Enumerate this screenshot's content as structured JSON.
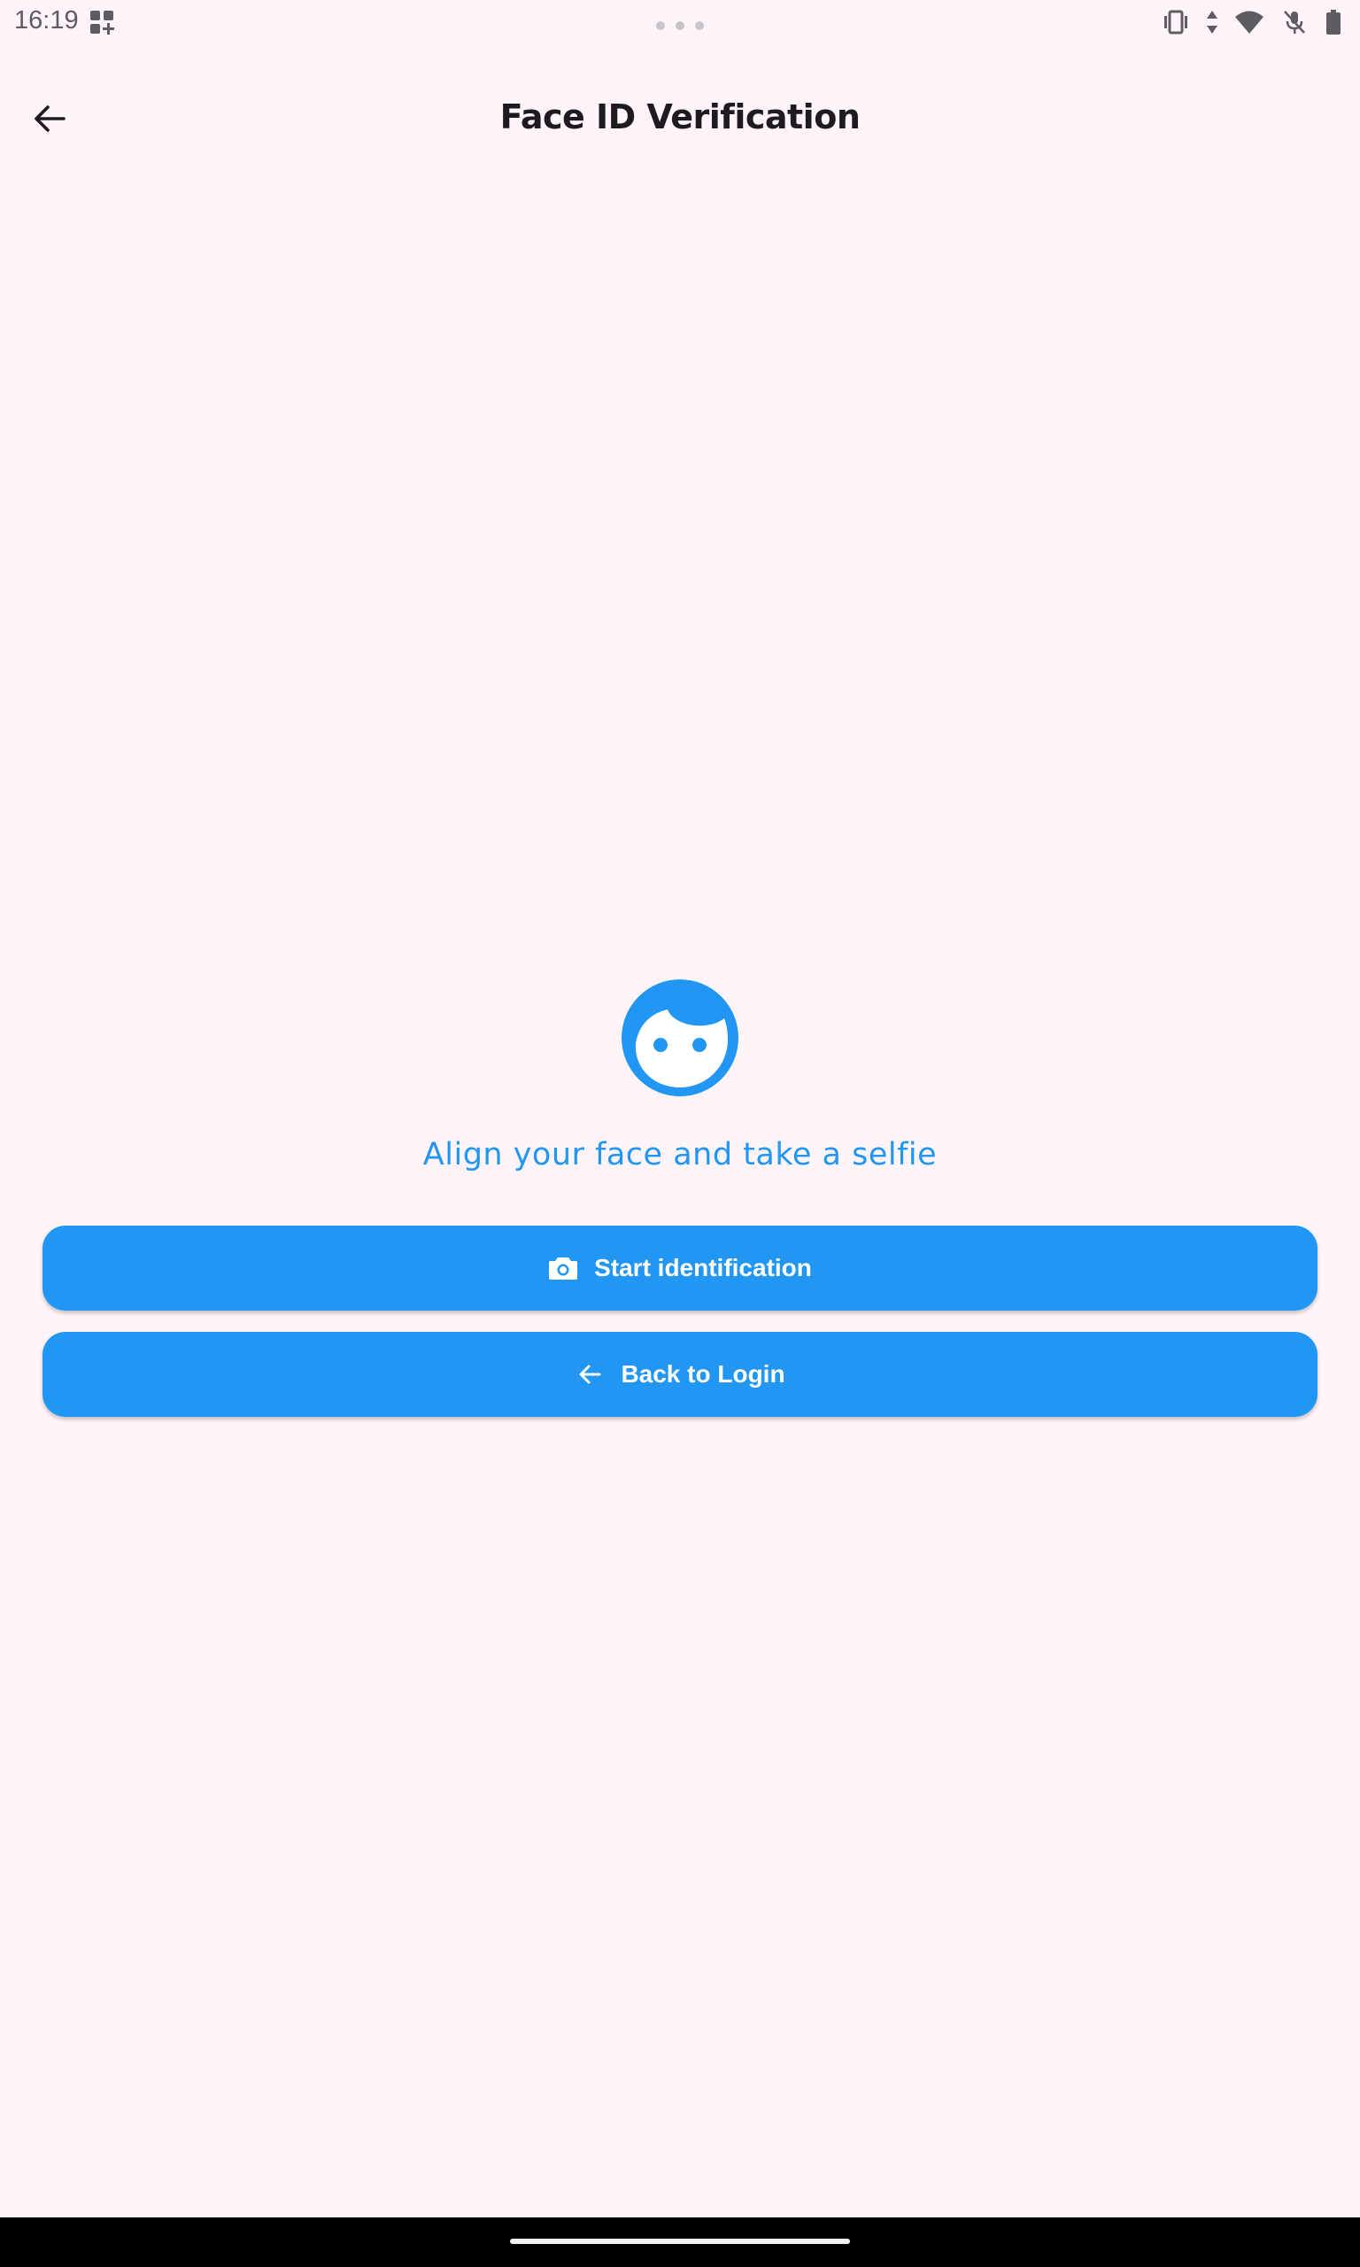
{
  "status_bar": {
    "time": "16:19",
    "icons": [
      "grid-add-icon",
      "vibrate-icon",
      "data-arrows-icon",
      "wifi-icon",
      "mic-off-icon",
      "battery-icon"
    ]
  },
  "app_bar": {
    "title": "Face ID Verification",
    "back_icon": "arrow-back-icon"
  },
  "main": {
    "face_icon": "face-icon",
    "instruction": "Align your face and take a selfie",
    "buttons": [
      {
        "label": "Start identification",
        "icon": "camera-icon"
      },
      {
        "label": "Back to Login",
        "icon": "arrow-back-icon"
      }
    ]
  },
  "colors": {
    "background": "#fff4fa",
    "accent": "#2196f3",
    "title_text": "#1d1b20",
    "button_text": "#ffffff"
  }
}
